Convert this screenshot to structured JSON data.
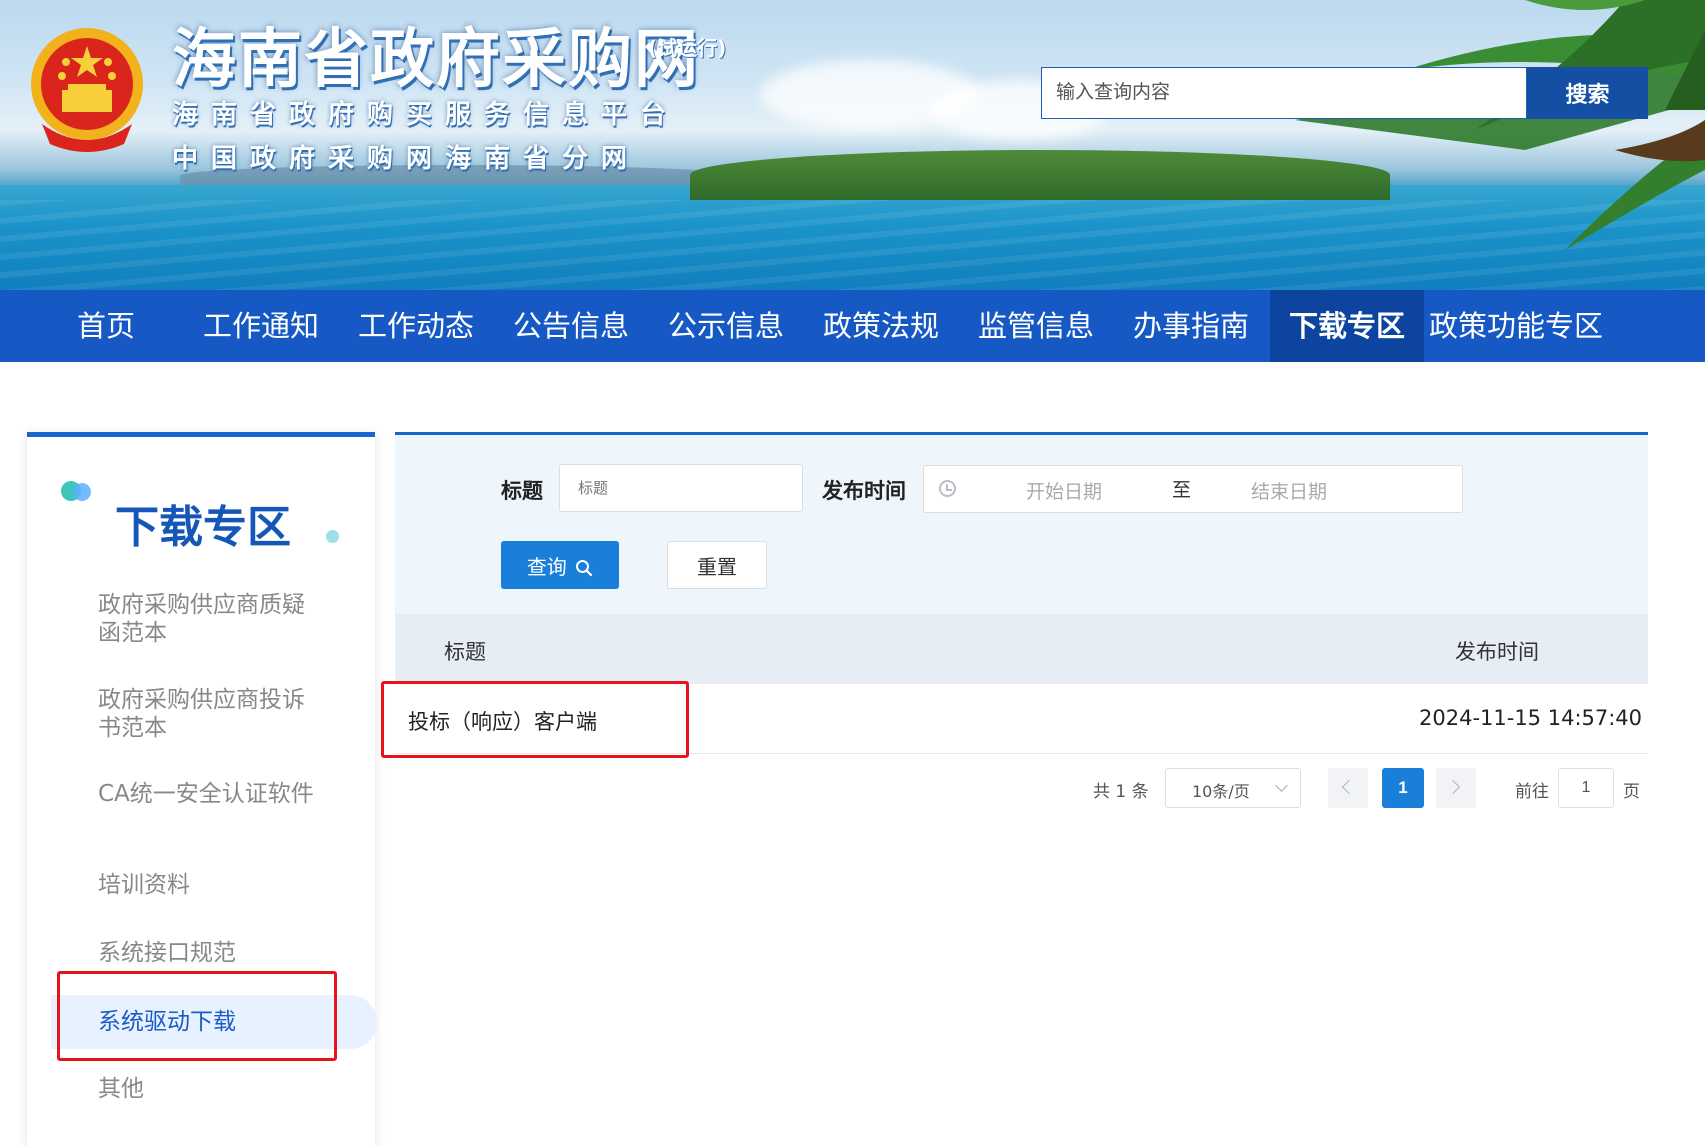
{
  "header": {
    "site_title": "海南省政府采购网",
    "site_title_tag": "(试运行)",
    "subtitle_1": "海南省政府购买服务信息平台",
    "subtitle_2": "中国政府采购网海南省分网",
    "search_placeholder": "输入查询内容",
    "search_button": "搜索"
  },
  "nav": {
    "items": [
      "首页",
      "工作通知",
      "工作动态",
      "公告信息",
      "公示信息",
      "政策法规",
      "监管信息",
      "办事指南",
      "下载专区",
      "政策功能专区"
    ],
    "active_index": 8
  },
  "sidebar": {
    "title": "下载专区",
    "items": [
      "政府采购供应商质疑函范本",
      "政府采购供应商投诉书范本",
      "CA统一安全认证软件",
      "培训资料",
      "系统接口规范",
      "系统驱动下载",
      "其他"
    ],
    "active_index": 5
  },
  "filter": {
    "title_label": "标题",
    "title_placeholder": "标题",
    "date_label": "发布时间",
    "start_placeholder": "开始日期",
    "range_sep": "至",
    "end_placeholder": "结束日期",
    "query_button": "查询",
    "reset_button": "重置"
  },
  "table": {
    "columns": [
      "标题",
      "发布时间"
    ],
    "rows": [
      {
        "title": "投标（响应）客户端",
        "time": "2024-11-15 14:57:40"
      }
    ]
  },
  "pagination": {
    "total": "共 1 条",
    "page_size": "10条/页",
    "current_page": "1",
    "goto_prefix": "前往",
    "goto_value": "1",
    "goto_suffix": "页"
  },
  "colors": {
    "nav_bg": "#1659c4",
    "nav_active": "#0d449f",
    "primary_button": "#1a7fd9",
    "highlight_box": "#e8141c"
  }
}
